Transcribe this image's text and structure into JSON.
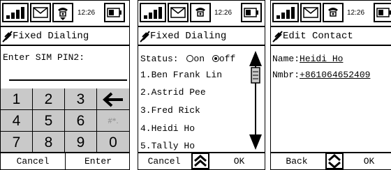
{
  "screens": [
    {
      "status": {
        "time": "12:26"
      },
      "title": "Fixed Dialing",
      "prompt": "Enter SIM PIN2:",
      "keypad": {
        "keys": [
          "1",
          "2",
          "3",
          "←",
          "4",
          "5",
          "6",
          "#*.",
          "7",
          "8",
          "9",
          "0"
        ]
      },
      "softkeys": {
        "left": "Cancel",
        "right": "Enter"
      }
    },
    {
      "status": {
        "time": "12:26"
      },
      "title": "Fixed Dialing",
      "status_line": {
        "label": "Status:",
        "on": "on",
        "off": "off",
        "selected": "off"
      },
      "list": [
        "1.Ben Frank Lin",
        "2.Astrid Pee",
        "3.Fred Rick",
        "4.Heidi Ho",
        "5.Tally Ho"
      ],
      "softkeys": {
        "left": "Cancel",
        "right": "OK"
      }
    },
    {
      "status": {
        "time": "12:26"
      },
      "title": "Edit Contact",
      "fields": {
        "name_label": "Name:",
        "name_value": "Heidi Ho",
        "number_label": "Nmbr:",
        "number_value": "+861064652409"
      },
      "softkeys": {
        "left": "Back",
        "right": "OK"
      }
    }
  ],
  "icons": {
    "signal": "signal-strength-icon",
    "message": "envelope-icon",
    "ringer": "ringer-icon",
    "battery": "battery-icon",
    "title": "feather-icon",
    "scroll_up": "arrow-up-icon",
    "scroll_down": "arrow-down-icon",
    "nav": "nav-arrows-icon",
    "backspace": "arrow-left-icon"
  }
}
